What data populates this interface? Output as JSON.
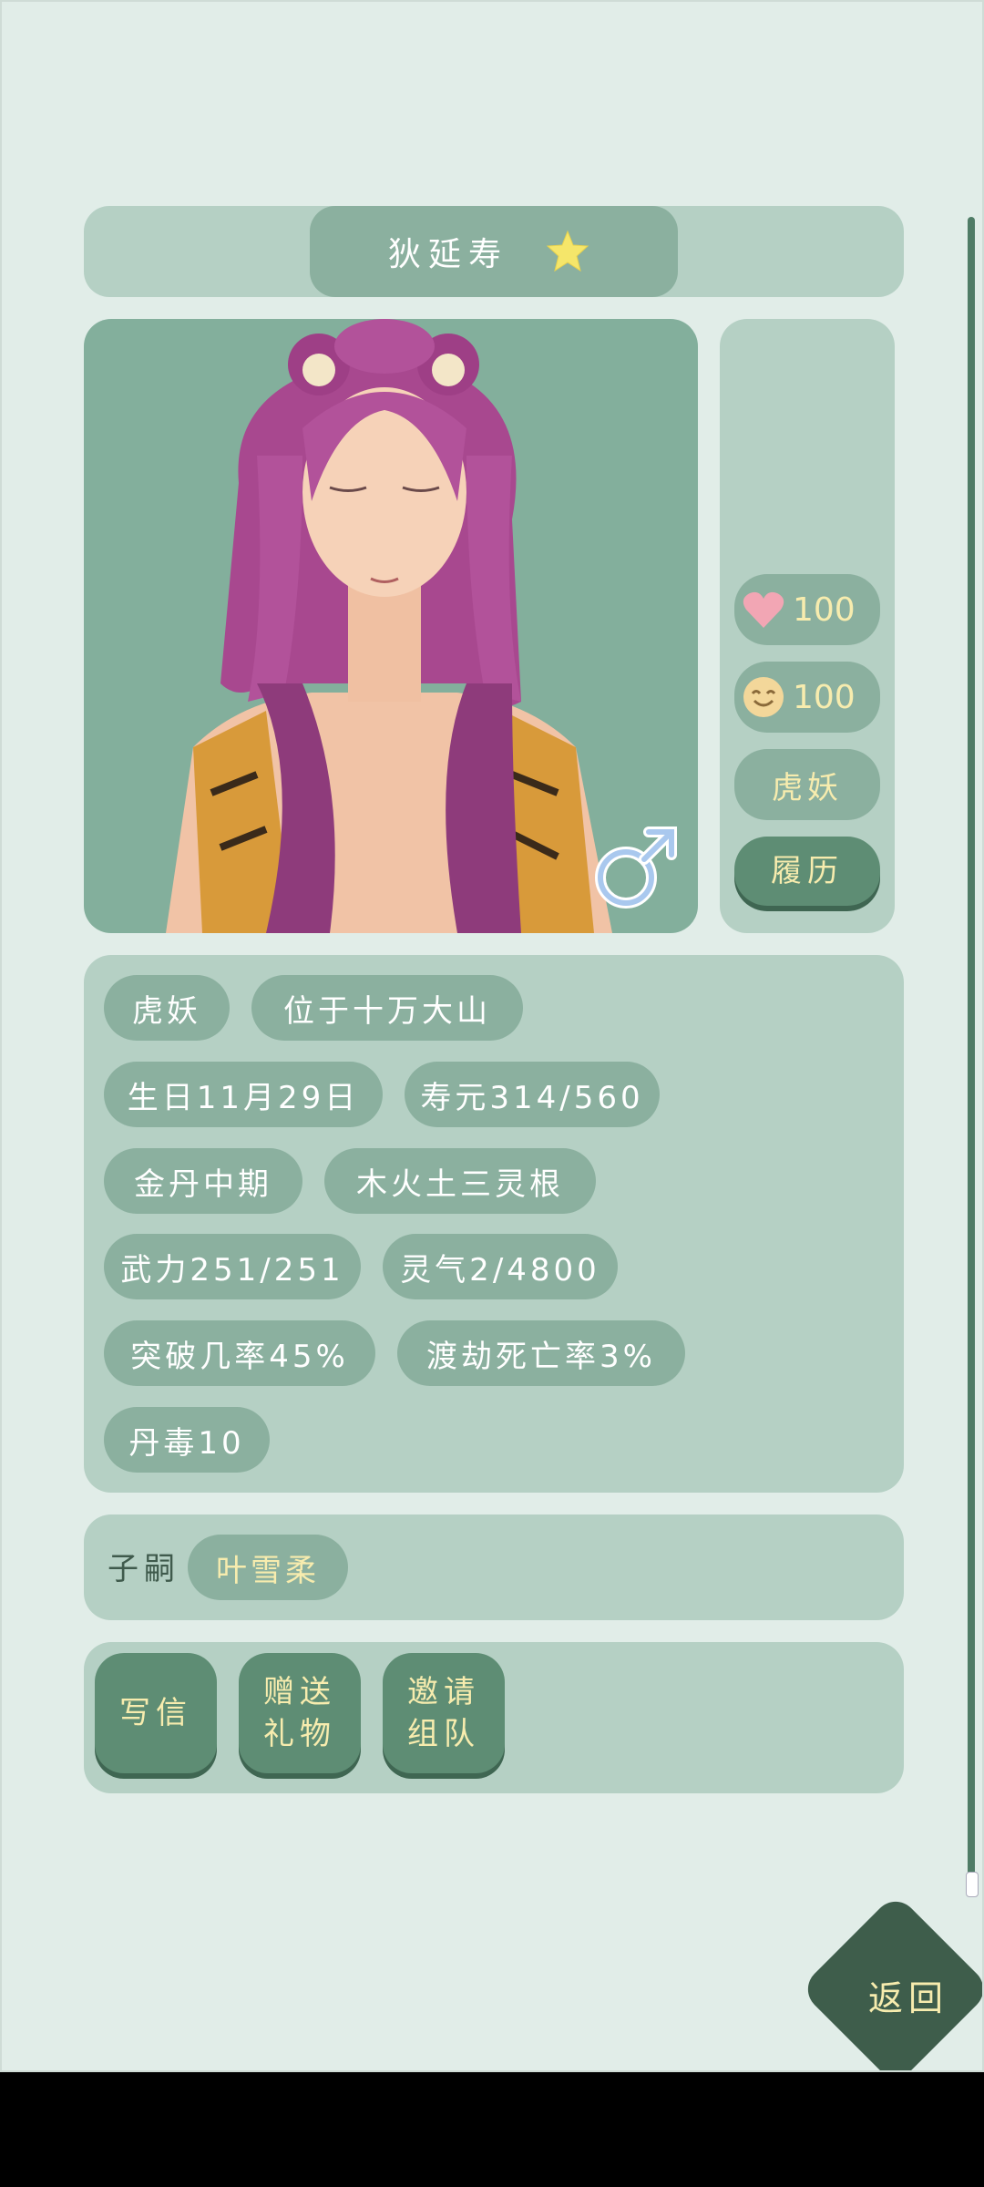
{
  "header": {
    "name": "狄延寿",
    "favorite_icon": "star-icon"
  },
  "side": {
    "affection": {
      "icon": "heart-icon",
      "value": "100"
    },
    "mood": {
      "icon": "smile-face-icon",
      "value": "100"
    },
    "race_button": "虎妖",
    "resume_button": "履历"
  },
  "portrait": {
    "gender_icon": "male-icon"
  },
  "attributes": [
    "虎妖",
    "位于十万大山",
    "生日11月29日",
    "寿元314/560",
    "金丹中期",
    "木火土三灵根",
    "武力251/251",
    "灵气2/4800",
    "突破几率45%",
    "渡劫死亡率3%",
    "丹毒10"
  ],
  "children": {
    "label": "子嗣",
    "items": [
      "叶雪柔"
    ]
  },
  "actions": {
    "write_letter": "写信",
    "give_gift": "赠送\n礼物",
    "invite_team": "邀请\n组队"
  },
  "back_button": "返回",
  "colors": {
    "background": "#e1ede8",
    "panel": "#b5d0c4",
    "pill": "#8bb09f",
    "button": "#5e8d74",
    "accent_text": "#f7ecae"
  }
}
